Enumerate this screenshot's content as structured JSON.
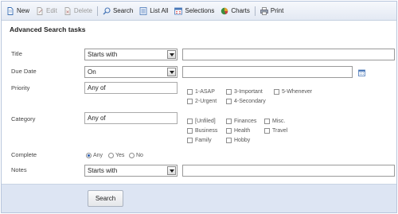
{
  "toolbar": {
    "new": "New",
    "edit": "Edit",
    "delete": "Delete",
    "search": "Search",
    "list_all": "List All",
    "selections": "Selections",
    "charts": "Charts",
    "print": "Print"
  },
  "heading": "Advanced Search tasks",
  "fields": {
    "title": {
      "label": "Title",
      "operator": "Starts with",
      "value": ""
    },
    "due_date": {
      "label": "Due Date",
      "operator": "On",
      "value": ""
    },
    "priority": {
      "label": "Priority",
      "mode": "Any of",
      "options": [
        "1-ASAP",
        "3-Important",
        "5-Whenever",
        "2-Urgent",
        "4-Secondary"
      ]
    },
    "category": {
      "label": "Category",
      "mode": "Any of",
      "options": [
        "[Unfiled]",
        "Finances",
        "Misc.",
        "Business",
        "Health",
        "Travel",
        "Family",
        "Hobby"
      ]
    },
    "complete": {
      "label": "Complete",
      "options": [
        "Any",
        "Yes",
        "No"
      ],
      "selected": "Any"
    },
    "notes": {
      "label": "Notes",
      "operator": "Starts with",
      "value": ""
    }
  },
  "search_button": "Search",
  "colors": {
    "toolbar_bg": "#e3e9f3",
    "footer_bg": "#dde5f3",
    "border": "#b8c6dc"
  }
}
